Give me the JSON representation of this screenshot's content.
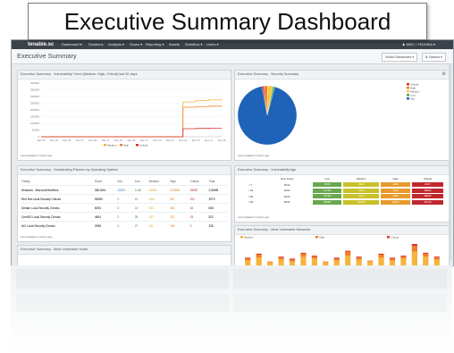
{
  "title_banner": "Executive Summary Dashboard",
  "nav": {
    "logo": "tenable.sc",
    "items": [
      "Dashboard ▾",
      "Solutions",
      "Analysis ▾",
      "Scans ▾",
      "Reporting ▾",
      "Assets",
      "Workflow ▾",
      "Users ▾"
    ],
    "user": "♟ MNC / YEDMNA ▾"
  },
  "page_title": "Executive Summary",
  "buttons": {
    "switch_dashboard": "Switch Dashboard ▾",
    "options": "⚙ Options ▾"
  },
  "panels": {
    "vuln_trend": {
      "title": "Executive Summary - Vulnerability Trend (Medium, High, Critical) last 30 days",
      "updated": "Last Updated: 9 hours ago",
      "legend": [
        "Medium",
        "High",
        "Critical"
      ]
    },
    "severity": {
      "title": "Executive Summary - Severity Summary",
      "updated": "Last Updated: 9 hours ago",
      "legend": [
        "Critical",
        "High",
        "Medium",
        "Low",
        "Info"
      ]
    },
    "patches": {
      "title": "Executive Summary - Outstanding Patches by Operating System",
      "updated": "Last Updated: 9 hours ago",
      "columns": [
        "Family",
        "Score",
        "Info",
        "Low",
        "Medium",
        "High",
        "Critical",
        "Total"
      ],
      "rows": [
        [
          "Windows : Microsoft Bulletins",
          "3601616",
          "10570",
          "1148",
          "10025",
          "225368",
          "35987",
          "215698"
        ],
        [
          "Red Hat Local Security Checks",
          "96389",
          "0",
          "16",
          "1211",
          "567",
          "291",
          "2979"
        ],
        [
          "Debian Local Security Checks",
          "6094",
          "0",
          "16",
          "244",
          "484",
          "48",
          "836"
        ],
        [
          "CentOS Local Security Checks",
          "4804",
          "0",
          "28",
          "227",
          "221",
          "33",
          "522"
        ],
        [
          "AIX Local Security Checks",
          "2998",
          "0",
          "27",
          "161",
          "160",
          "9",
          "335"
        ]
      ]
    },
    "most_vuln_hosts": {
      "title": "Executive Summary - Most Vulnerable Hosts"
    },
    "vuln_age": {
      "title": "Executive Summary - Vulnerability Age",
      "updated": "Last Updated: 9 hours ago",
      "columns": [
        "",
        "Host Hosts",
        "Low",
        "Medium",
        "High",
        "Critical"
      ],
      "rows": [
        [
          "< 7",
          "3016",
          "6702",
          "2311",
          "1201",
          "2217"
        ],
        [
          "> 30",
          "6202",
          "12764",
          "4413",
          "1981",
          "49662"
        ],
        [
          "> 60",
          "6215",
          "12764",
          "4413",
          "1981",
          "49662"
        ],
        [
          "> 90",
          "5844",
          "39666",
          "12004",
          "10971",
          "33744"
        ]
      ]
    },
    "networks": {
      "title": "Executive Summary - Most Vulnerable Networks",
      "legend": [
        "Medium",
        "High",
        "Critical"
      ]
    }
  },
  "chart_data": [
    {
      "type": "line",
      "title": "Executive Summary - Vulnerability Trend (Medium, High, Critical) last 30 days",
      "x": [
        "Dec 01",
        "Dec 03",
        "Dec 05",
        "Dec 07",
        "Dec 09",
        "Dec 11",
        "Dec 13",
        "Dec 15",
        "Dec 17",
        "Dec 19",
        "Dec 21",
        "Dec 23",
        "Dec 25",
        "Dec 27",
        "Dec 29"
      ],
      "y_ticks": [
        "0",
        "50000",
        "100000",
        "150000",
        "200000",
        "250000",
        "300000",
        "350000",
        "400000"
      ],
      "ylim": [
        0,
        400000
      ],
      "series": [
        {
          "name": "Medium",
          "color": "#f5b43c",
          "values": [
            0,
            0,
            0,
            0,
            0,
            0,
            0,
            0,
            0,
            0,
            0,
            260000,
            270000,
            275000,
            280000
          ]
        },
        {
          "name": "High",
          "color": "#f07f2a",
          "values": [
            0,
            0,
            0,
            0,
            0,
            0,
            0,
            0,
            0,
            0,
            0,
            220000,
            225000,
            228000,
            230000
          ]
        },
        {
          "name": "Critical",
          "color": "#d9342b",
          "values": [
            0,
            0,
            0,
            0,
            0,
            0,
            0,
            0,
            0,
            0,
            0,
            60000,
            62000,
            64000,
            65000
          ]
        }
      ]
    },
    {
      "type": "pie",
      "title": "Executive Summary - Severity Summary",
      "categories": [
        "Critical",
        "High",
        "Medium",
        "Low",
        "Info"
      ],
      "values": [
        1,
        2,
        3,
        1,
        93
      ],
      "colors": [
        "#d9342b",
        "#f07f2a",
        "#f5c842",
        "#48a84b",
        "#1f63b8"
      ]
    },
    {
      "type": "bar",
      "title": "Executive Summary - Most Vulnerable Networks",
      "series": [
        {
          "name": "Medium",
          "color": "#f5b43c",
          "values": [
            5,
            8,
            3,
            6,
            4,
            9,
            7,
            3,
            5,
            10,
            6,
            4,
            8,
            5,
            7,
            14,
            9,
            6
          ]
        },
        {
          "name": "High",
          "color": "#f07f2a",
          "values": [
            2,
            3,
            1,
            2,
            2,
            3,
            2,
            1,
            2,
            4,
            2,
            1,
            3,
            2,
            2,
            6,
            3,
            2
          ]
        },
        {
          "name": "Critical",
          "color": "#d9342b",
          "values": [
            1,
            1,
            0,
            1,
            1,
            1,
            1,
            0,
            1,
            1,
            1,
            0,
            1,
            1,
            1,
            2,
            1,
            1
          ]
        }
      ]
    }
  ],
  "colors": {
    "low": "#6aa84f",
    "medium": "#c9c12a",
    "high": "#e69a2d",
    "critical": "#c0272d"
  }
}
